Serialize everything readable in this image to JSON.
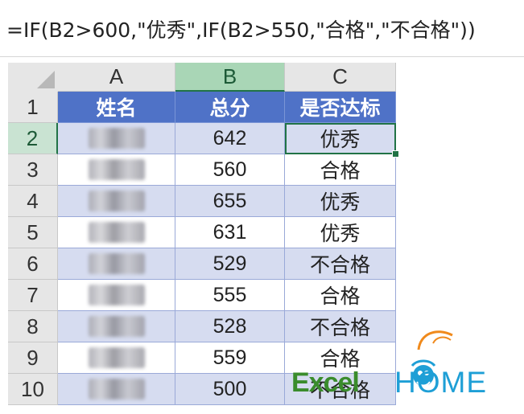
{
  "formula_bar": {
    "text": "=IF(B2>600,\"优秀\",IF(B2>550,\"合格\",\"不合格\"))"
  },
  "columns": [
    "A",
    "B",
    "C"
  ],
  "selected_column": "B",
  "rows": [
    {
      "num": "1",
      "a": "姓名",
      "b": "总分",
      "c": "是否达标"
    },
    {
      "num": "2",
      "a": "",
      "b": "642",
      "c": "优秀"
    },
    {
      "num": "3",
      "a": "",
      "b": "560",
      "c": "合格"
    },
    {
      "num": "4",
      "a": "",
      "b": "655",
      "c": "优秀"
    },
    {
      "num": "5",
      "a": "",
      "b": "631",
      "c": "优秀"
    },
    {
      "num": "6",
      "a": "",
      "b": "529",
      "c": "不合格"
    },
    {
      "num": "7",
      "a": "",
      "b": "555",
      "c": "合格"
    },
    {
      "num": "8",
      "a": "",
      "b": "528",
      "c": "不合格"
    },
    {
      "num": "9",
      "a": "",
      "b": "559",
      "c": "合格"
    },
    {
      "num": "10",
      "a": "",
      "b": "500",
      "c": "不合格"
    }
  ],
  "active_cell": "C2",
  "colors": {
    "header_fill": "#4f72c7",
    "band_fill": "#d6dcf0",
    "selection": "#217346",
    "logo_excel": "#3a8c2c",
    "logo_home": "#1e9fd6"
  },
  "logo": {
    "part1": "Excel",
    "part2": "HOME"
  }
}
